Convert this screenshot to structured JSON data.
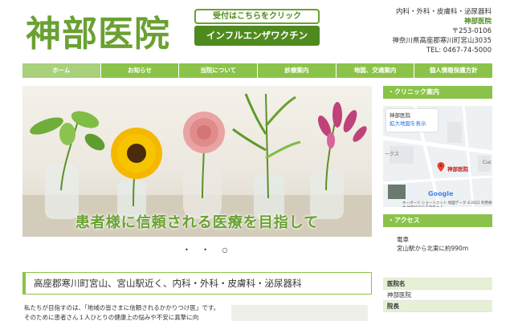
{
  "header": {
    "site_title": "神部医院",
    "banner_top": "受付はこちらをクリック",
    "banner_bottom": "インフルエンザワクチン",
    "departments": "内科・外科・皮膚科・泌尿器科",
    "clinic_name": "神部医院",
    "postal": "〒253-0106",
    "address": "神奈川県高座郡寒川町宮山3035",
    "tel": "TEL: 0467-74-5000"
  },
  "nav": {
    "items": [
      "ホーム",
      "お知らせ",
      "当院について",
      "診療案内",
      "地図、交通案内",
      "個人情報保護方針"
    ]
  },
  "hero": {
    "caption": "患者様に信頼される医療を目指して",
    "dots": "• • ○"
  },
  "main": {
    "heading": "高座郡寒川町宮山、宮山駅近く、内科・外科・皮膚科・泌尿器科",
    "intro": "私たちが目指すのは、「地域の皆さまに信頼されるかかりつけ医」です。そのために患者さん１人ひとりの健康上の悩みや不安に真摯に向"
  },
  "sidebar": {
    "map_heading": "・クリニック案内",
    "map_card_title": "神部医院",
    "map_card_link": "拡大地図を表示",
    "map_pin_label": "神部医院",
    "map_google": "Google",
    "map_footer": "キーボード ショートカット 地図データ ©2022 利用規約 地図の誤りを報告する",
    "access_heading": "・アクセス",
    "access_line1": "電車",
    "access_line2": "宮山駅から北東に約990m",
    "info_label1": "医院名",
    "info_value1": "神部医院",
    "info_label2": "院長"
  },
  "colors": {
    "brand_green": "#6aa132",
    "nav_green": "#8bc34a",
    "dark_green": "#4f8a1f"
  }
}
